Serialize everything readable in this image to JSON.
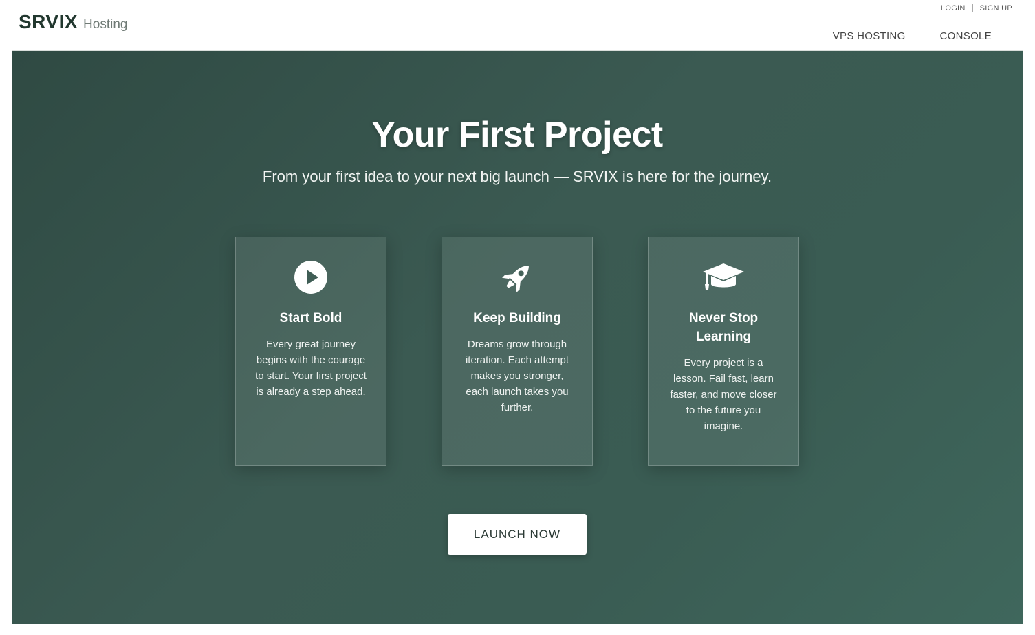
{
  "header": {
    "brand_name": "SRVIX",
    "brand_sub": "Hosting",
    "auth": {
      "login": "LOGIN",
      "signup": "SIGN UP"
    },
    "nav": {
      "vps": "VPS HOSTING",
      "console": "CONSOLE"
    }
  },
  "hero": {
    "title": "Your First Project",
    "subtitle": "From your first idea to your next big launch — SRVIX is here for the journey.",
    "cards": [
      {
        "icon": "play-circle-icon",
        "title": "Start Bold",
        "text": "Every great journey begins with the courage to start. Your first project is already a step ahead."
      },
      {
        "icon": "rocket-icon",
        "title": "Keep Building",
        "text": "Dreams grow through iteration. Each attempt makes you stronger, each launch takes you further."
      },
      {
        "icon": "graduation-cap-icon",
        "title": "Never Stop Learning",
        "text": "Every project is a lesson. Fail fast, learn faster, and move closer to the future you imagine."
      }
    ],
    "cta_label": "LAUNCH NOW"
  },
  "colors": {
    "hero_bg": "#3a5a51",
    "brand_text": "#22382f",
    "cta_bg": "#ffffff"
  }
}
